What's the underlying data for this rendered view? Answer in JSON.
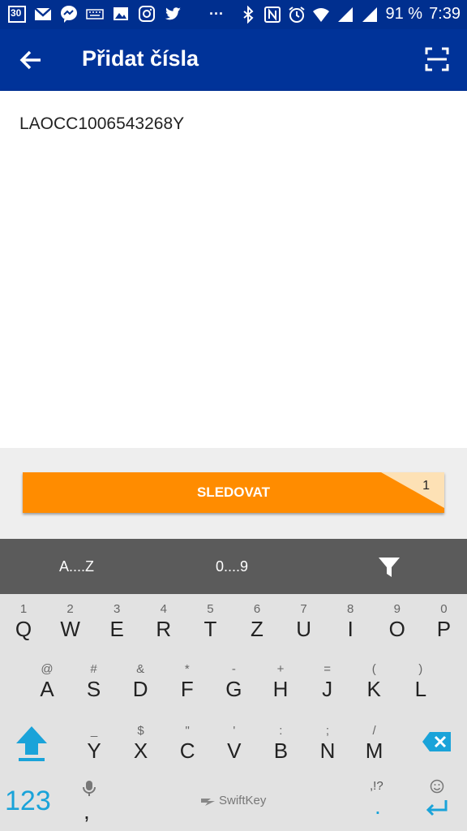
{
  "status_bar": {
    "calendar_day": "30",
    "battery": "91 %",
    "time": "7:39",
    "overflow": "···"
  },
  "app_bar": {
    "title": "Přidat čísla"
  },
  "tracking_input": {
    "value": "LAOCC1006543268Y"
  },
  "track_button": {
    "label": "SLEDOVAT",
    "count": "1"
  },
  "keyboard": {
    "top_bar": {
      "letters": "A....Z",
      "digits": "0....9"
    },
    "row1": [
      {
        "sub": "1",
        "main": "Q"
      },
      {
        "sub": "2",
        "main": "W"
      },
      {
        "sub": "3",
        "main": "E"
      },
      {
        "sub": "4",
        "main": "R"
      },
      {
        "sub": "5",
        "main": "T"
      },
      {
        "sub": "6",
        "main": "Z"
      },
      {
        "sub": "7",
        "main": "U"
      },
      {
        "sub": "8",
        "main": "I"
      },
      {
        "sub": "9",
        "main": "O"
      },
      {
        "sub": "0",
        "main": "P"
      }
    ],
    "row2": [
      {
        "sub": "@",
        "main": "A"
      },
      {
        "sub": "#",
        "main": "S"
      },
      {
        "sub": "&",
        "main": "D"
      },
      {
        "sub": "*",
        "main": "F"
      },
      {
        "sub": "-",
        "main": "G"
      },
      {
        "sub": "+",
        "main": "H"
      },
      {
        "sub": "=",
        "main": "J"
      },
      {
        "sub": "(",
        "main": "K"
      },
      {
        "sub": ")",
        "main": "L"
      }
    ],
    "row3": [
      {
        "sub": "_",
        "main": "Y"
      },
      {
        "sub": "$",
        "main": "X"
      },
      {
        "sub": "\"",
        "main": "C"
      },
      {
        "sub": "'",
        "main": "V"
      },
      {
        "sub": ":",
        "main": "B"
      },
      {
        "sub": ";",
        "main": "N"
      },
      {
        "sub": "/",
        "main": "M"
      }
    ],
    "bottom": {
      "numbers": "123",
      "comma": ",",
      "space": "SwiftKey",
      "punct_sub": ",!?",
      "period": "."
    }
  },
  "colors": {
    "app_bar": "#003399",
    "status_bar": "#002f8f",
    "accent": "#ff8c00",
    "shift": "#1aa3d9"
  }
}
